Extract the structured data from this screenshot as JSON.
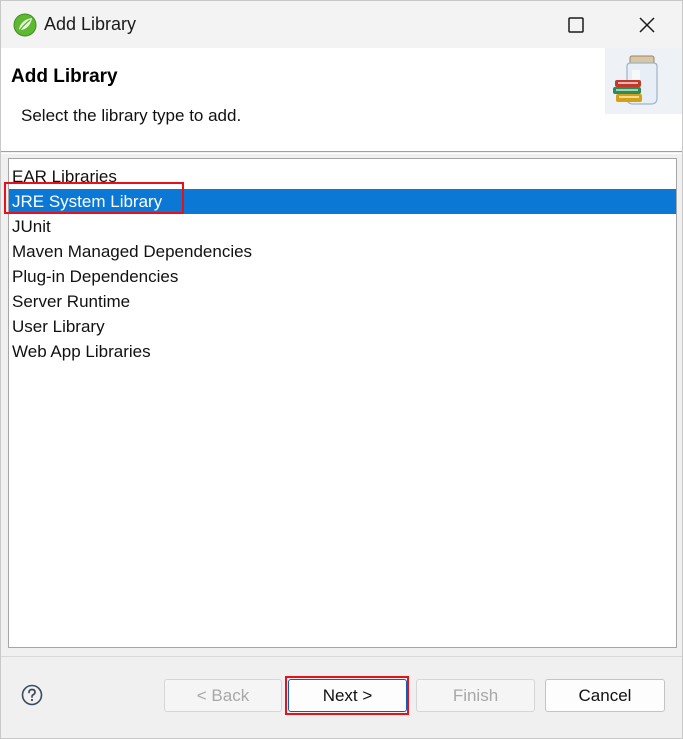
{
  "window": {
    "title": "Add Library"
  },
  "banner": {
    "title": "Add Library",
    "description": "Select the library type to add."
  },
  "library_types": [
    {
      "label": "EAR Libraries",
      "selected": false
    },
    {
      "label": "JRE System Library",
      "selected": true
    },
    {
      "label": "JUnit",
      "selected": false
    },
    {
      "label": "Maven Managed Dependencies",
      "selected": false
    },
    {
      "label": "Plug-in Dependencies",
      "selected": false
    },
    {
      "label": "Server Runtime",
      "selected": false
    },
    {
      "label": "User Library",
      "selected": false
    },
    {
      "label": "Web App Libraries",
      "selected": false
    }
  ],
  "buttons": {
    "back": "< Back",
    "next": "Next >",
    "finish": "Finish",
    "cancel": "Cancel"
  },
  "icons": {
    "app": "spring-leaf-icon",
    "maximize": "maximize-icon",
    "close": "close-icon",
    "banner": "library-jar-icon",
    "help": "help-icon"
  },
  "colors": {
    "selection": "#0a78d4",
    "annotation": "#e8101a"
  }
}
